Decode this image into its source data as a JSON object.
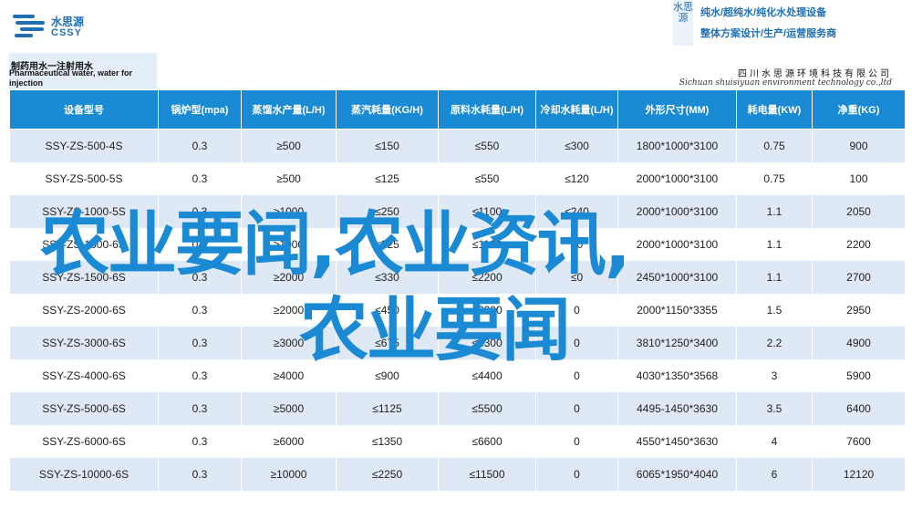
{
  "header": {
    "logo_cn": "水思源",
    "logo_en": "CSSY",
    "vertical_brand": "水思源",
    "tagline_1": "纯水/超纯水/纯化水处理设备",
    "tagline_2": "整体方案设计/生产/运营服务商"
  },
  "title": {
    "cn": "制药用水一注射用水",
    "en": "Pharmaceutical water, water for injection",
    "company_cn": "四川水思源环境科技有限公司",
    "company_en": "Sichuan shuisiyuan environment technology co.,ltd"
  },
  "table": {
    "headers": [
      "设备型号",
      "锅炉型(mpa)",
      "蒸馏水产量(L/H)",
      "蒸汽耗量(KG/H)",
      "原料水耗量(L/H)",
      "冷却水耗量(L/H)",
      "外形尺寸(MM)",
      "耗电量(KW)",
      "净重(KG)"
    ],
    "rows": [
      [
        "SSY-ZS-500-4S",
        "0.3",
        "≥500",
        "≤150",
        "≤550",
        "≤300",
        "1800*1000*3100",
        "0.75",
        "900"
      ],
      [
        "SSY-ZS-500-5S",
        "0.3",
        "≥500",
        "≤125",
        "≤550",
        "≤120",
        "2000*1000*3100",
        "0.75",
        "100"
      ],
      [
        "SSY-ZS-1000-5S",
        "0.3",
        "≥1000",
        "≤250",
        "≤1100",
        "≤240",
        "2000*1000*3100",
        "1.1",
        "2050"
      ],
      [
        "SSY-ZS-1000-6S",
        "0.3",
        "≥1000",
        "≤225",
        "≤1100",
        "≤0",
        "2000*1000*3100",
        "1.1",
        "2200"
      ],
      [
        "SSY-ZS-1500-6S",
        "0.3",
        "≥2000",
        "≤330",
        "≤2200",
        "≤0",
        "2450*1000*3100",
        "1.1",
        "2700"
      ],
      [
        "SSY-ZS-2000-6S",
        "0.3",
        "≥2000",
        "≤450",
        "≤2200",
        "0",
        "2000*1150*3355",
        "1.5",
        "2950"
      ],
      [
        "SSY-ZS-3000-6S",
        "0.3",
        "≥3000",
        "≤675",
        "≤3300",
        "0",
        "3810*1250*3400",
        "2.2",
        "4900"
      ],
      [
        "SSY-ZS-4000-6S",
        "0.3",
        "≥4000",
        "≤900",
        "≤4400",
        "0",
        "4030*1350*3568",
        "3",
        "5900"
      ],
      [
        "SSY-ZS-5000-6S",
        "0.3",
        "≥5000",
        "≤1125",
        "≤5500",
        "0",
        "4495-1450*3630",
        "3.5",
        "6400"
      ],
      [
        "SSY-ZS-6000-6S",
        "0.3",
        "≥6000",
        "≤1350",
        "≤6600",
        "0",
        "4550*1450*3630",
        "4",
        "7600"
      ],
      [
        "SSY-ZS-10000-6S",
        "0.3",
        "≥10000",
        "≤2250",
        "≤11500",
        "0",
        "6065*1950*4040",
        "6",
        "12120"
      ]
    ]
  },
  "overlay": {
    "line1": "农业要闻,农业资讯,",
    "line2": "农业要闻"
  }
}
